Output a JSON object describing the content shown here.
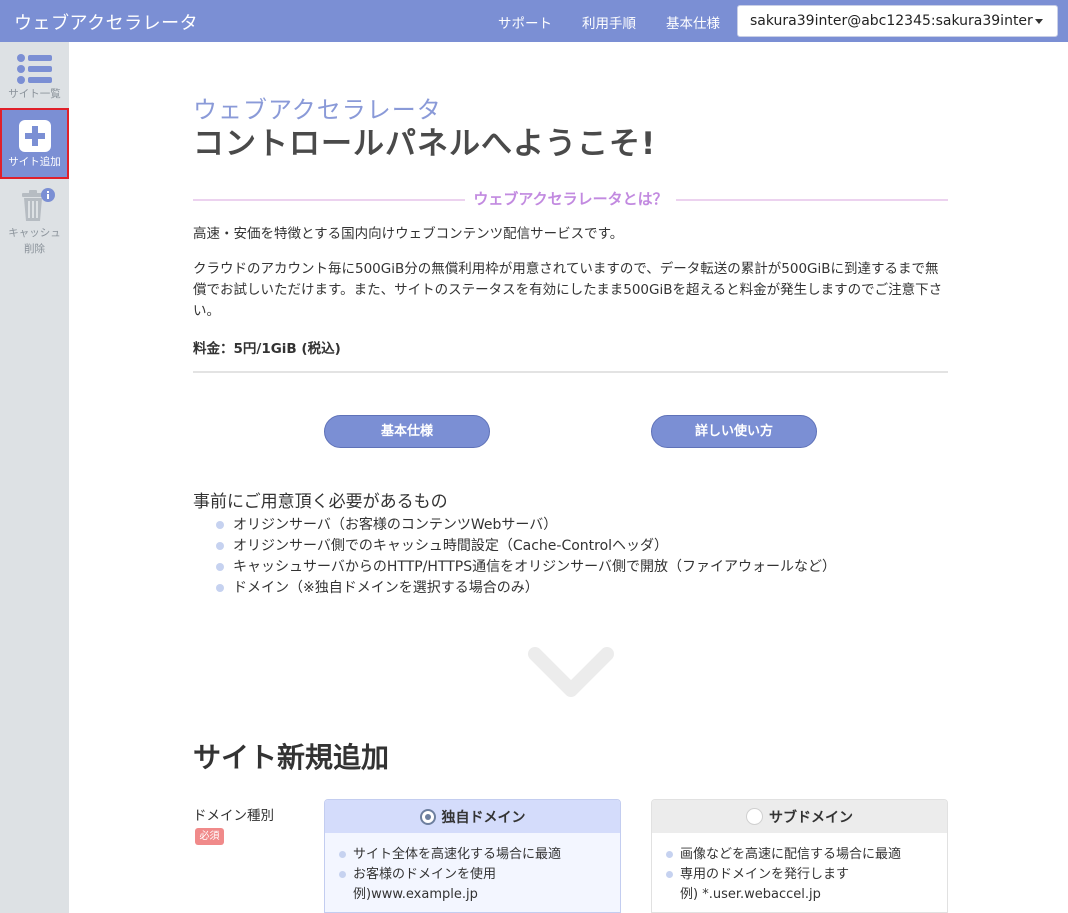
{
  "header": {
    "app_title": "ウェブアクセラレータ",
    "nav": [
      "サポート",
      "利用手順",
      "基本仕様"
    ],
    "account": "sakura39inter@abc12345:sakura39inter"
  },
  "sidebar": {
    "items": [
      {
        "label": "サイト一覧",
        "icon": "list-icon"
      },
      {
        "label": "サイト追加",
        "icon": "plus-icon",
        "active": true
      },
      {
        "label_line1": "キャッシュ",
        "label_line2": "削除",
        "icon": "trash-icon",
        "disabled": true
      }
    ]
  },
  "welcome": {
    "subtitle": "ウェブアクセラレータ",
    "title": "コントロールパネルへようこそ!"
  },
  "about": {
    "heading": "ウェブアクセラレータとは？",
    "p1": "高速・安価を特徴とする国内向けウェブコンテンツ配信サービスです。",
    "p2": "クラウドのアカウント毎に500GiB分の無償利用枠が用意されていますので、データ転送の累計が500GiBに到達するまで無償でお試しいただけます。また、サイトのステータスを有効にしたまま500GiBを超えると料金が発生しますのでご注意下さい。",
    "price": "料金：5円/1GiB (税込)"
  },
  "buttons": {
    "spec": "基本仕様",
    "howto": "詳しい使い方"
  },
  "requirements": {
    "title": "事前にご用意頂く必要があるもの",
    "items": [
      "オリジンサーバ（お客様のコンテンツWebサーバ）",
      "オリジンサーバ側でのキャッシュ時間設定（Cache-Controlヘッダ）",
      "キャッシュサーバからのHTTP/HTTPS通信をオリジンサーバ側で開放（ファイアウォールなど）",
      "ドメイン（※独自ドメインを選択する場合のみ）"
    ]
  },
  "new_site": {
    "title": "サイト新規追加",
    "domain_type_label": "ドメイン種別",
    "required_badge": "必須",
    "options": [
      {
        "label": "独自ドメイン",
        "selected": true,
        "bullets": [
          "サイト全体を高速化する場合に最適",
          "お客様のドメインを使用"
        ],
        "example": "例)www.example.jp"
      },
      {
        "label": "サブドメイン",
        "selected": false,
        "bullets": [
          "画像などを高速に配信する場合に最適",
          "専用のドメインを発行します"
        ],
        "example": "例) *.user.webaccel.jp"
      }
    ]
  },
  "colors": {
    "brand": "#7b8fd4",
    "accent_pink": "#c28ae0",
    "required_red": "#f08a8a"
  }
}
